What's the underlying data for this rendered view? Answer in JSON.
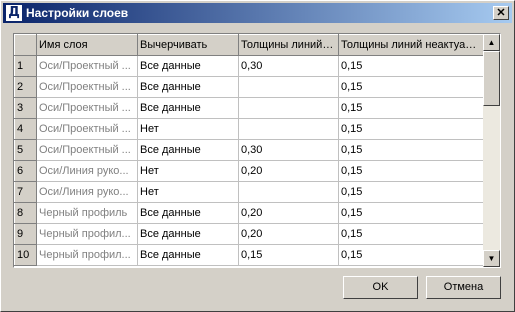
{
  "window": {
    "icon_glyph": "Д",
    "title": "Настройки слоев",
    "close_glyph": "✕"
  },
  "table": {
    "columns": [
      "Имя слоя",
      "Вычерчивать",
      "Толщины линий ак",
      "Толщины линий неактуальн"
    ],
    "rows": [
      {
        "num": "1",
        "name": "Оси/Проектный ...",
        "draw": "Все данные",
        "active": "0,30",
        "inactive": "0,15"
      },
      {
        "num": "2",
        "name": "Оси/Проектный ...",
        "draw": "Все данные",
        "active": "",
        "inactive": "0,15"
      },
      {
        "num": "3",
        "name": "Оси/Проектный ...",
        "draw": "Все данные",
        "active": "",
        "inactive": "0,15"
      },
      {
        "num": "4",
        "name": "Оси/Проектный ...",
        "draw": "Нет",
        "active": "",
        "inactive": "0,15"
      },
      {
        "num": "5",
        "name": "Оси/Проектный ...",
        "draw": "Все данные",
        "active": "0,30",
        "inactive": "0,15"
      },
      {
        "num": "6",
        "name": "Оси/Линия руко...",
        "draw": "Нет",
        "active": "0,20",
        "inactive": "0,15"
      },
      {
        "num": "7",
        "name": "Оси/Линия руко...",
        "draw": "Нет",
        "active": "",
        "inactive": "0,15"
      },
      {
        "num": "8",
        "name": "Черный профиль",
        "draw": "Все данные",
        "active": "0,20",
        "inactive": "0,15"
      },
      {
        "num": "9",
        "name": "Черный профил...",
        "draw": "Все данные",
        "active": "0,20",
        "inactive": "0,15"
      },
      {
        "num": "10",
        "name": "Черный профил...",
        "draw": "Все данные",
        "active": "0,15",
        "inactive": "0,15"
      }
    ]
  },
  "scrollbar": {
    "up_glyph": "▲",
    "down_glyph": "▼"
  },
  "buttons": {
    "ok": "OK",
    "cancel": "Отмена"
  }
}
